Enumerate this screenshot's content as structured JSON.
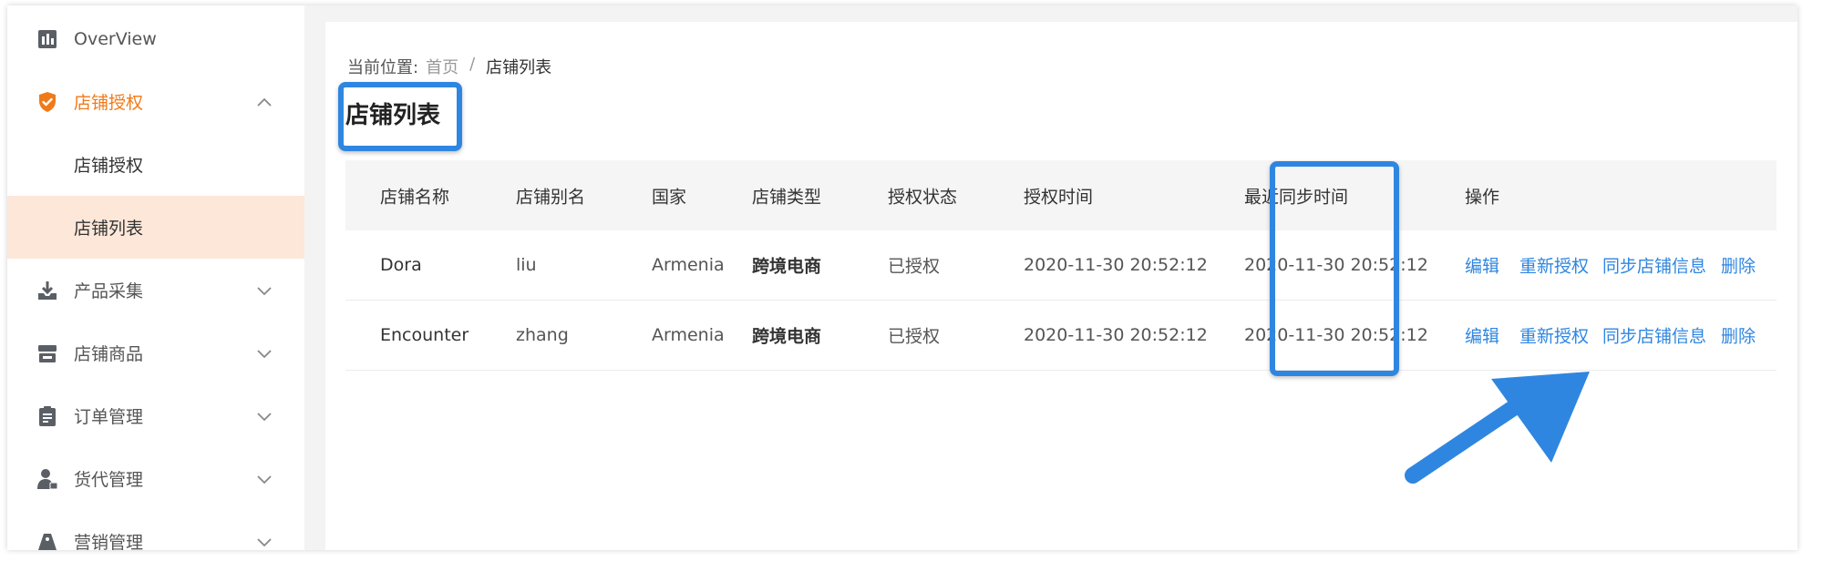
{
  "sidebar": {
    "items": [
      {
        "label": "OverView",
        "icon": "bar-chart-icon"
      },
      {
        "label": "店铺授权",
        "icon": "shield-check-icon",
        "active": true
      },
      {
        "label": "店铺授权",
        "sub": true
      },
      {
        "label": "店铺列表",
        "sub": true,
        "selected": true
      },
      {
        "label": "产品采集",
        "icon": "download-tray-icon"
      },
      {
        "label": "店铺商品",
        "icon": "store-icon"
      },
      {
        "label": "订单管理",
        "icon": "clipboard-icon"
      },
      {
        "label": "货代管理",
        "icon": "person-icon"
      },
      {
        "label": "营销管理",
        "icon": "tag-icon"
      }
    ]
  },
  "breadcrumb": {
    "prefix": "当前位置:",
    "home": "首页",
    "separator": "/",
    "current": "店铺列表"
  },
  "page": {
    "title": "店铺列表"
  },
  "table": {
    "headers": [
      "店铺名称",
      "店铺别名",
      "国家",
      "店铺类型",
      "授权状态",
      "授权时间",
      "最近同步时间",
      "操作"
    ],
    "rows": [
      {
        "name": "Dora",
        "alias": "liu",
        "country": "Armenia",
        "type": "跨境电商",
        "status": "已授权",
        "auth_time": "2020-11-30 20:52:12",
        "sync_time": "2020-11-30 20:52:12"
      },
      {
        "name": "Encounter",
        "alias": "zhang",
        "country": "Armenia",
        "type": "跨境电商",
        "status": "已授权",
        "auth_time": "2020-11-30 20:52:12",
        "sync_time": "2020-11-30 20:52:12"
      }
    ],
    "actions": {
      "edit": "编辑",
      "reauth": "重新授权",
      "sync": "同步店铺信息",
      "delete": "删除"
    }
  },
  "colors": {
    "accent_orange": "#f07a1a",
    "selected_bg": "#fde7d9",
    "link_blue": "#2f86e0",
    "highlight_blue": "#2f86e0"
  }
}
